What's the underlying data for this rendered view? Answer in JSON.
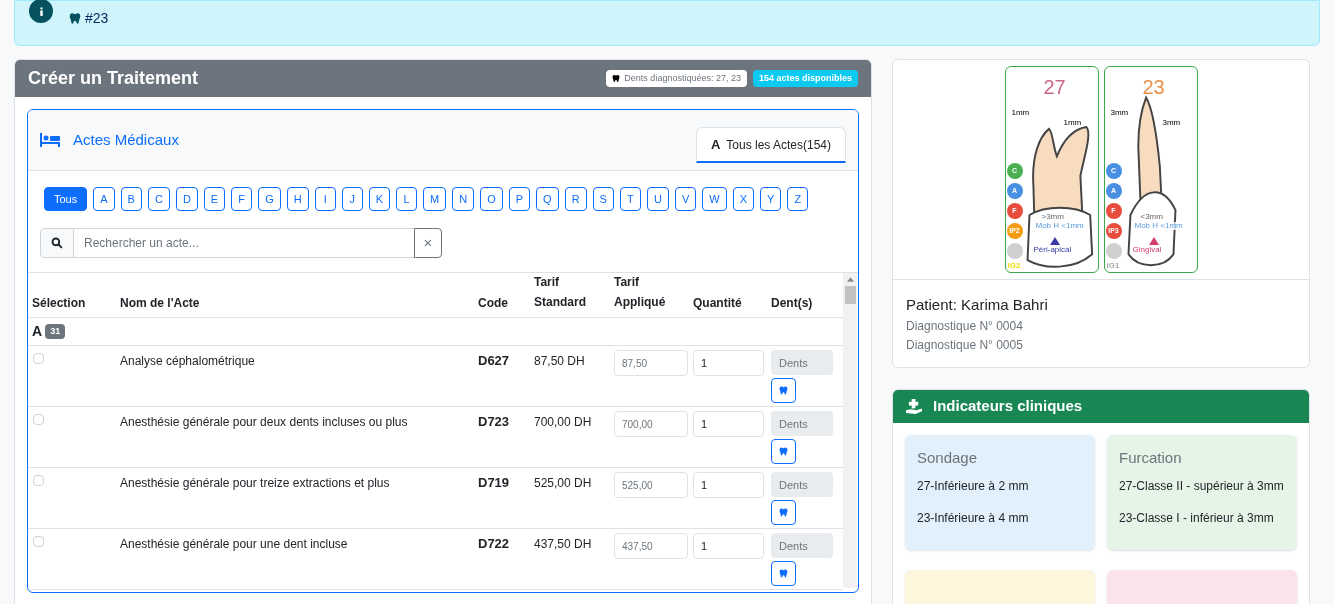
{
  "alert": {
    "lines": [
      "#23"
    ]
  },
  "treatment": {
    "title": "Créer un Traitement",
    "teeth_badge": "Dents diagnostiquées: 27, 23",
    "count_badge": "154 actes disponibles",
    "section": {
      "title": "Actes Médicaux",
      "tabs": [
        {
          "icon": "A",
          "label": "Tous les Actes(154)",
          "selected": true
        }
      ]
    },
    "letters": [
      {
        "label": "Tous",
        "selected": true
      },
      {
        "label": "A",
        "selected": false
      },
      {
        "label": "B",
        "selected": false
      },
      {
        "label": "C",
        "selected": false
      },
      {
        "label": "D",
        "selected": false
      },
      {
        "label": "E",
        "selected": false
      },
      {
        "label": "F",
        "selected": false
      },
      {
        "label": "G",
        "selected": false
      },
      {
        "label": "H",
        "selected": false
      },
      {
        "label": "I",
        "selected": false
      },
      {
        "label": "J",
        "selected": false
      },
      {
        "label": "K",
        "selected": false
      },
      {
        "label": "L",
        "selected": false
      },
      {
        "label": "M",
        "selected": false
      },
      {
        "label": "N",
        "selected": false
      },
      {
        "label": "O",
        "selected": false
      },
      {
        "label": "P",
        "selected": false
      },
      {
        "label": "Q",
        "selected": false
      },
      {
        "label": "R",
        "selected": false
      },
      {
        "label": "S",
        "selected": false
      },
      {
        "label": "T",
        "selected": false
      },
      {
        "label": "U",
        "selected": false
      },
      {
        "label": "V",
        "selected": false
      },
      {
        "label": "W",
        "selected": false
      },
      {
        "label": "X",
        "selected": false
      },
      {
        "label": "Y",
        "selected": false
      },
      {
        "label": "Z",
        "selected": false
      }
    ],
    "search": {
      "placeholder": "Rechercher un acte...",
      "clear": "×"
    },
    "table": {
      "columns": [
        "Sélection",
        "Nom de l'Acte",
        "Code",
        "Tarif Standard",
        "Tarif Appliqué",
        "Quantité",
        "Dent(s)"
      ],
      "groups": [
        {
          "letter": "A",
          "count": "31",
          "rows": [
            {
              "checked": false,
              "name": "Analyse céphalométrique",
              "code": "D627",
              "tarif": "87,50 DH",
              "applied": "87,50",
              "quantity": "1",
              "teeth_placeholder": "Dents"
            },
            {
              "checked": false,
              "name": "Anesthésie générale pour deux dents incluses ou plus",
              "code": "D723",
              "tarif": "700,00 DH",
              "applied": "700,00",
              "quantity": "1",
              "teeth_placeholder": "Dents"
            },
            {
              "checked": false,
              "name": "Anesthésie générale pour treize extractions et plus",
              "code": "D719",
              "tarif": "525,00 DH",
              "applied": "525,00",
              "quantity": "1",
              "teeth_placeholder": "Dents"
            },
            {
              "checked": false,
              "name": "Anesthésie générale pour une dent incluse",
              "code": "D722",
              "tarif": "437,50 DH",
              "applied": "437,50",
              "quantity": "1",
              "teeth_placeholder": "Dents"
            }
          ]
        }
      ]
    }
  },
  "patient": {
    "teeth": [
      {
        "number": {
          "text": "27",
          "color": "#c96a8a"
        },
        "kind": "molar",
        "probing": [
          "1mm",
          "1mm"
        ],
        "furcation": ">3mm",
        "mobility": "Mob H <1mm",
        "lesion": {
          "text": "Péri-apical",
          "color": "#3a3aa8"
        },
        "markers": [
          {
            "label": "C",
            "color": "#4caf50"
          },
          {
            "label": "A",
            "color": "#4a90e2"
          },
          {
            "label": "F",
            "color": "#e74c3c"
          },
          {
            "label": "IP2",
            "color": "#f39c12"
          }
        ],
        "gum": {
          "text": "IG2",
          "color": "#f5d90a"
        }
      },
      {
        "number": {
          "text": "23",
          "color": "#e8914a"
        },
        "kind": "canine",
        "probing": [
          "3mm",
          "3mm"
        ],
        "furcation": "<3mm",
        "mobility": "Mob H <1mm",
        "lesion": {
          "text": "Gingival",
          "color": "#d0406a"
        },
        "markers": [
          {
            "label": "C",
            "color": "#4a90e2"
          },
          {
            "label": "A",
            "color": "#4a90e2"
          },
          {
            "label": "F",
            "color": "#e74c3c"
          },
          {
            "label": "IP3",
            "color": "#e74c3c"
          }
        ],
        "gum": {
          "text": "IG1",
          "color": "#a9a9a9"
        }
      }
    ],
    "name": "Patient: Karima Bahri",
    "lines": [
      "Diagnostique N° 0004",
      "Diagnostique N° 0005"
    ]
  },
  "indicators": {
    "title": "Indicateurs cliniques",
    "cards": [
      {
        "title": "Sondage",
        "color": "#e1f0fb",
        "lines": [
          "27-Inférieure à 2 mm",
          "23-Inférieure à 4 mm"
        ]
      },
      {
        "title": "Furcation",
        "color": "#e6f4e8",
        "lines": [
          "27-Classe II - supérieur à 3mm",
          "23-Classe I - inférieur à 3mm"
        ]
      },
      {
        "color": "#fdf6dd"
      },
      {
        "color": "#fbe3ea"
      }
    ]
  }
}
